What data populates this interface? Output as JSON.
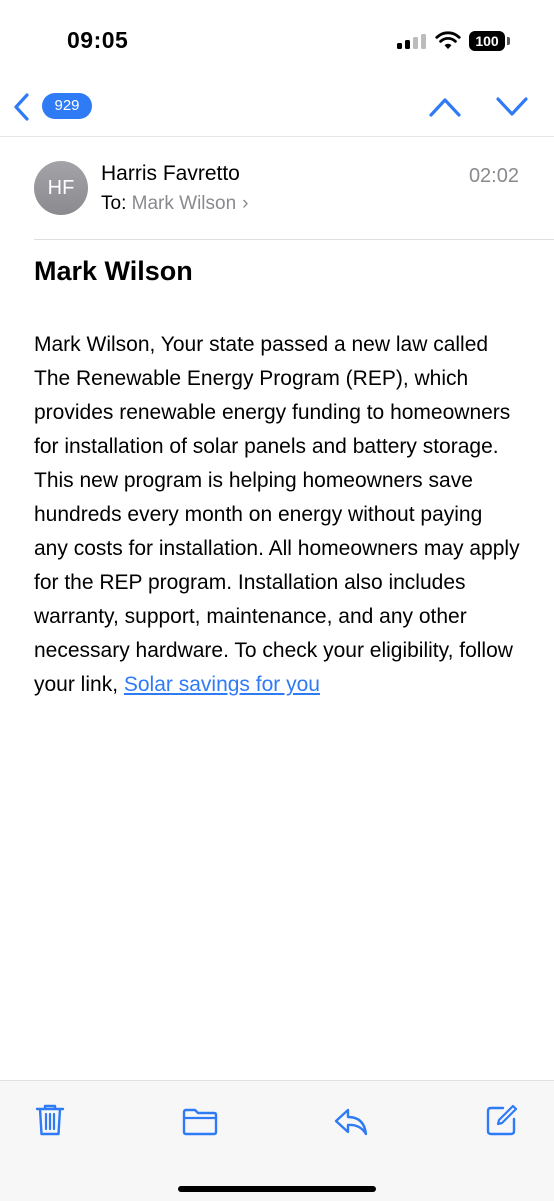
{
  "status": {
    "time": "09:05",
    "battery": "100"
  },
  "nav": {
    "message_count": "929"
  },
  "email": {
    "avatar_initials": "HF",
    "sender": "Harris Favretto",
    "time": "02:02",
    "to_label": "To:",
    "to_name": "Mark Wilson",
    "subject": "Mark Wilson",
    "body": "Mark Wilson, Your state passed a new law called The Renewable Energy Program (REP), which provides renewable energy funding to homeowners for installation of solar panels and battery storage. This new program is helping homeowners save hundreds every month on energy without paying any costs for installation. All homeowners may apply for the REP program. Installation also includes warranty, support, maintenance, and any other necessary hardware. To check your eligibility, follow your link,",
    "link_text": "Solar savings for you"
  },
  "icons": {
    "back": "chevron-left-icon",
    "up": "chevron-up-icon",
    "down": "chevron-down-icon",
    "trash": "trash-icon",
    "folder": "folder-icon",
    "reply": "reply-icon",
    "compose": "compose-icon"
  },
  "colors": {
    "accent": "#2f7bf6",
    "secondary_text": "#8a8a8e",
    "toolbar_bg": "#f7f7f8"
  }
}
